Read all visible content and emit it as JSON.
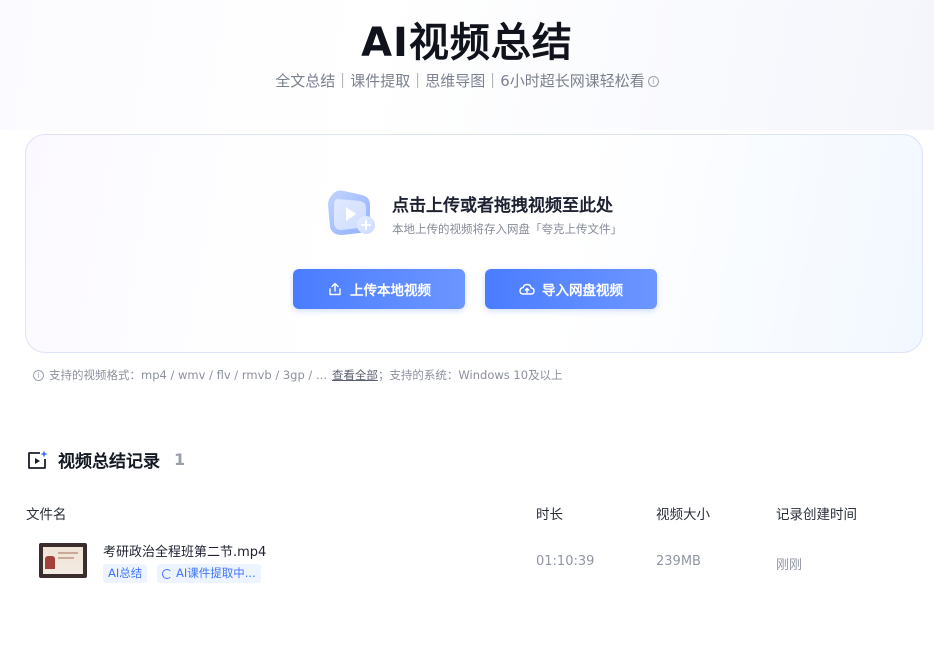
{
  "header": {
    "title": "AI视频总结",
    "subtitle": "全文总结｜课件提取｜思维导图｜6小时超长网课轻松看"
  },
  "upload": {
    "title": "点击上传或者拖拽视频至此处",
    "description": "本地上传的视频将存入网盘「夸克上传文件」",
    "local_button": "上传本地视频",
    "cloud_button": "导入网盘视频",
    "formats_text": "支持的视频格式：mp4 / wmv / flv / rmvb / 3gp / ...",
    "view_all_link": "查看全部",
    "system_text": "；支持的系统：Windows 10及以上"
  },
  "records": {
    "title": "视频总结记录",
    "count": "1",
    "columns": {
      "name": "文件名",
      "duration": "时长",
      "size": "视频大小",
      "created": "记录创建时间"
    },
    "rows": [
      {
        "file_name": "考研政治全程班第二节.mp4",
        "tag_summary": "AI总结",
        "tag_extract": "AI课件提取中...",
        "duration": "01:10:39",
        "size": "239MB",
        "created": "刚刚"
      }
    ]
  },
  "colors": {
    "accent": "#4a7cff",
    "tag_bg": "#eef4ff",
    "tag_text": "#3f74ff"
  },
  "icons": [
    "info-icon",
    "video-upload-icon",
    "upload-icon",
    "cloud-icon",
    "record-sparkle-icon",
    "spinner-icon"
  ]
}
